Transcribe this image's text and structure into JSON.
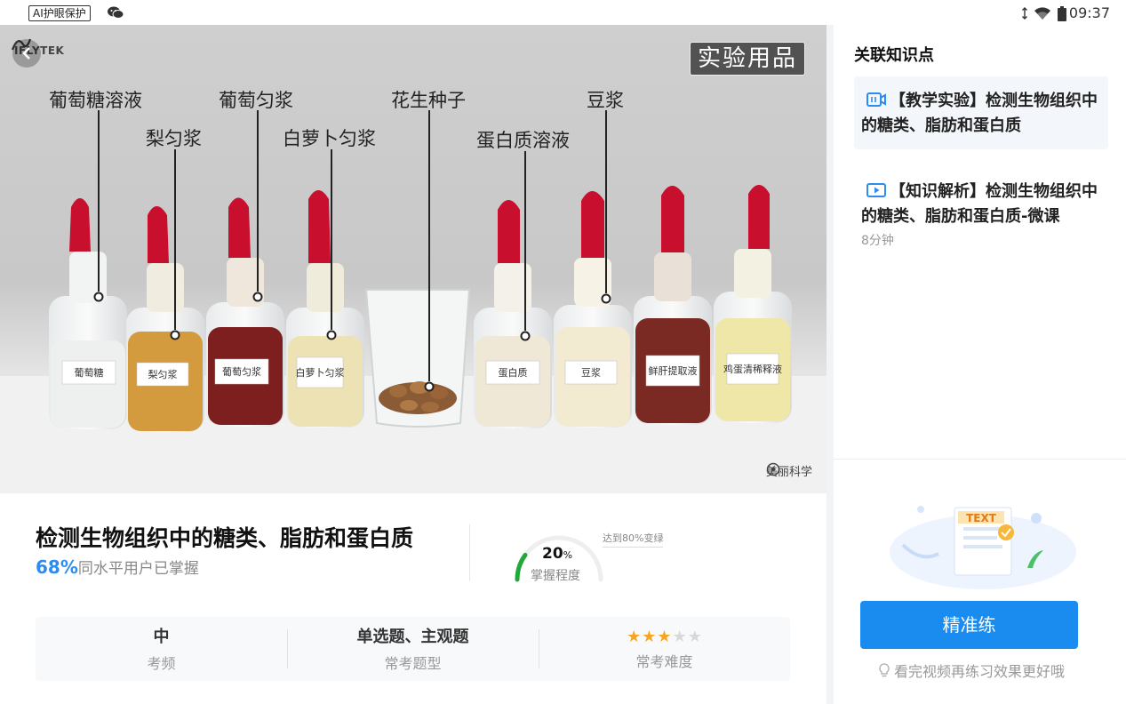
{
  "status_bar": {
    "eye_badge": "AI护眼保护",
    "time": "09:37",
    "icons": [
      "wechat-icon",
      "vibrate-icon",
      "wifi-icon",
      "battery-icon"
    ]
  },
  "video": {
    "logo": "IFLYTEK",
    "corner_tag": "实验用品",
    "watermark": "美丽科学",
    "callouts": [
      "葡萄糖溶液",
      "梨匀浆",
      "葡萄匀浆",
      "白萝卜匀浆",
      "花生种子",
      "蛋白质溶液",
      "豆浆"
    ],
    "bottle_labels": [
      "葡萄糖",
      "梨匀浆",
      "葡萄匀浆",
      "白萝卜匀浆",
      "蛋白质",
      "豆浆",
      "鲜肝提取液",
      "鸡蛋清稀释液"
    ]
  },
  "lesson": {
    "title": "检测生物组织中的糖类、脂肪和蛋白质",
    "peer_percent": "68%",
    "peer_text": "同水平用户已掌握",
    "mastery_value": "20",
    "mastery_unit": "%",
    "mastery_label": "掌握程度",
    "mastery_fraction": 0.2,
    "mastery_hint": "达到80%变绿",
    "accent_color": "#2d8cf0",
    "gauge_color": "#22a83a"
  },
  "stats": {
    "frequency_value": "中",
    "frequency_label": "考频",
    "types_value": "单选题、主观题",
    "types_label": "常考题型",
    "difficulty_stars": 3,
    "difficulty_max": 5,
    "difficulty_label": "常考难度"
  },
  "panel": {
    "title": "关联知识点",
    "items": [
      {
        "text": "【教学实验】检测生物组织中的糖类、脂肪和蛋白质",
        "duration": ""
      },
      {
        "text": "【知识解析】检测生物组织中的糖类、脂肪和蛋白质-微课",
        "duration": "8分钟"
      }
    ],
    "illustration_text": "TEXT",
    "practice_button": "精准练",
    "tip": "看完视频再练习效果更好哦"
  }
}
